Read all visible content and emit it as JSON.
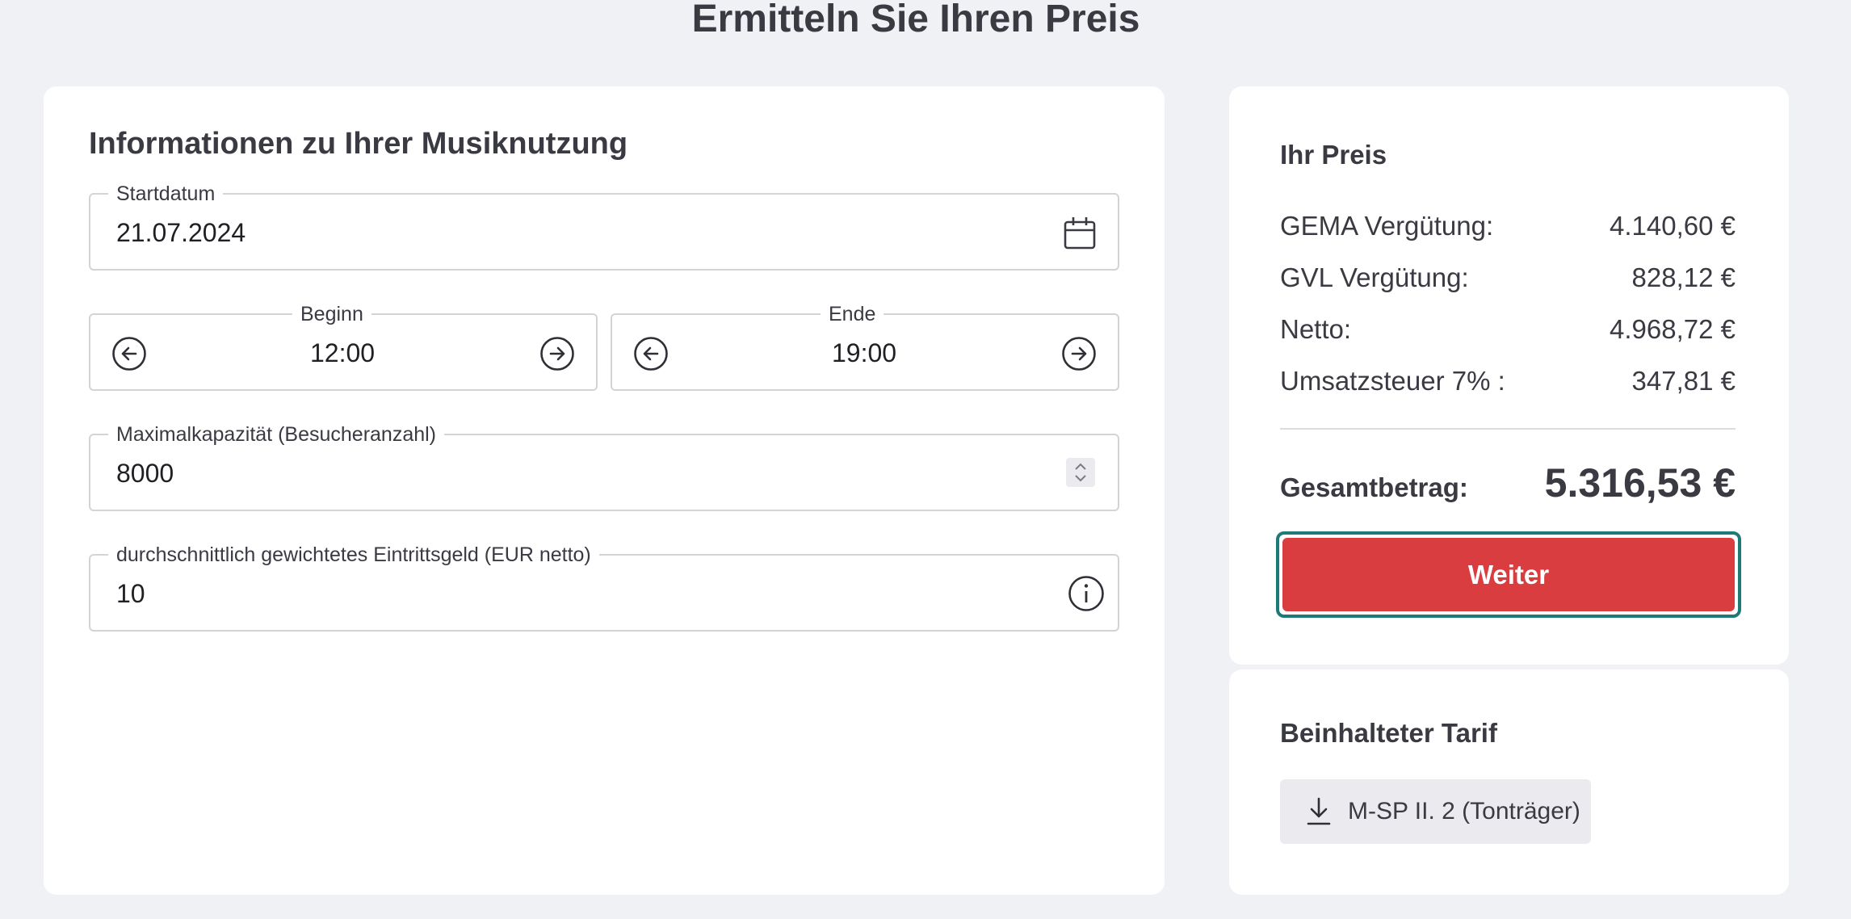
{
  "page": {
    "title": "Ermitteln Sie Ihren Preis"
  },
  "form": {
    "title": "Informationen zu Ihrer Musiknutzung",
    "startdatum": {
      "label": "Startdatum",
      "value": "21.07.2024"
    },
    "beginn": {
      "label": "Beginn",
      "value": "12:00"
    },
    "ende": {
      "label": "Ende",
      "value": "19:00"
    },
    "kapazitaet": {
      "label": "Maximalkapazität (Besucheranzahl)",
      "value": "8000"
    },
    "eintritt": {
      "label": "durchschnittlich gewichtetes Eintrittsgeld (EUR netto)",
      "value": "10"
    }
  },
  "price": {
    "title": "Ihr Preis",
    "rows": [
      {
        "label": "GEMA Vergütung:",
        "value": "4.140,60 €"
      },
      {
        "label": "GVL Vergütung:",
        "value": "828,12 €"
      },
      {
        "label": "Netto:",
        "value": "4.968,72 €"
      },
      {
        "label": "Umsatzsteuer 7% :",
        "value": "347,81 €"
      }
    ],
    "total_label": "Gesamtbetrag:",
    "total_value": "5.316,53 €",
    "button_label": "Weiter"
  },
  "tarif": {
    "title": "Beinhalteter Tarif",
    "download_label": "M-SP II. 2 (Tonträger)"
  },
  "icons": {
    "calendar": "calendar-icon",
    "prev": "arrow-left-circle-icon",
    "next": "arrow-right-circle-icon",
    "stepper": "chevron-up-down-icon",
    "info": "info-icon",
    "download": "download-icon"
  },
  "colors": {
    "accent_red": "#d93d3f",
    "focus_ring": "#1e7a77",
    "background": "#f0f1f5"
  }
}
